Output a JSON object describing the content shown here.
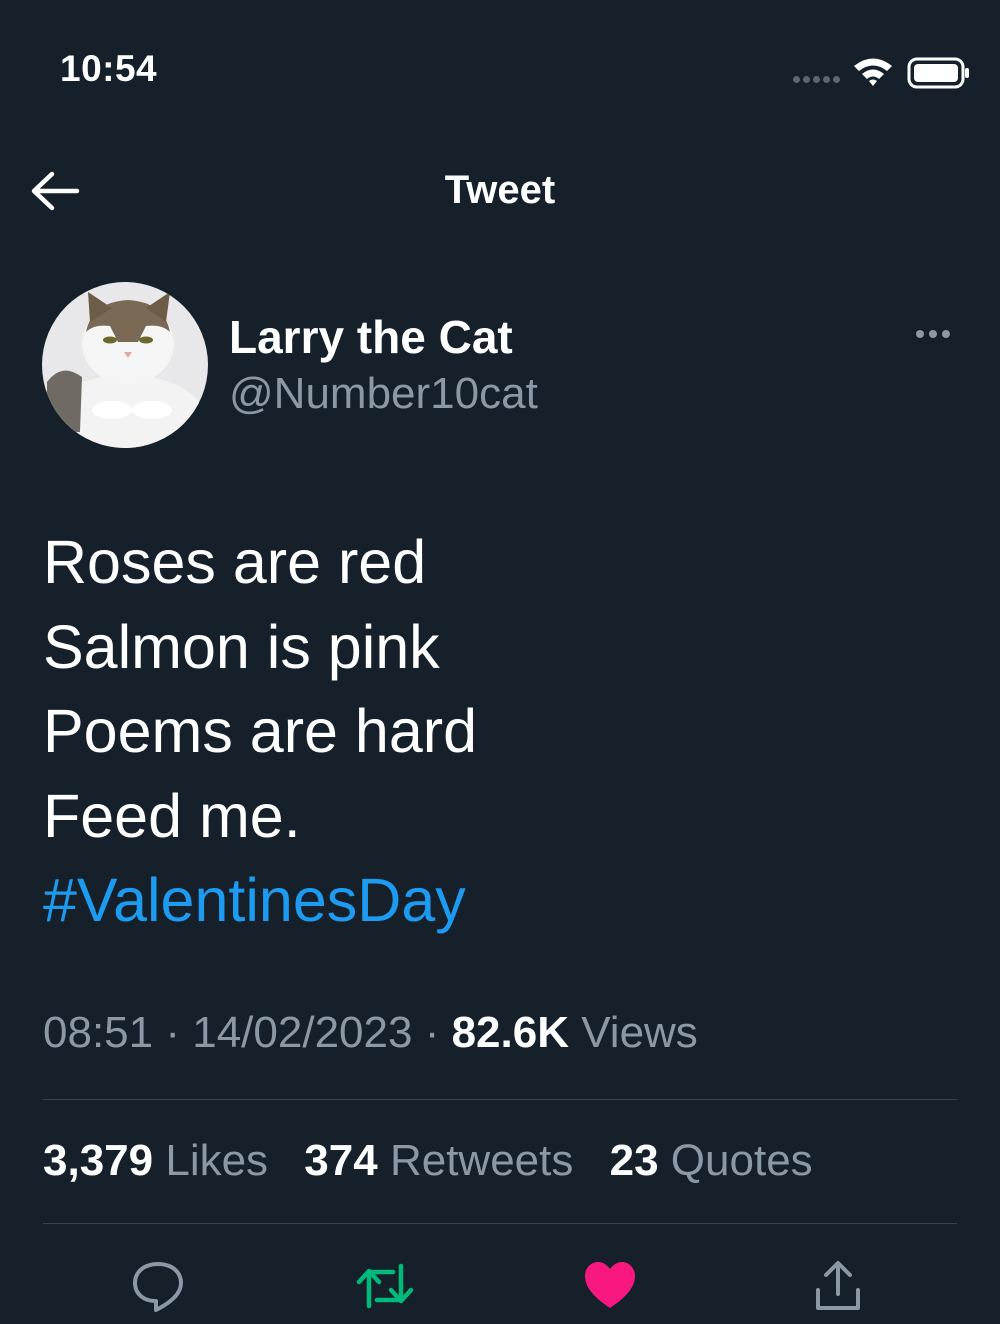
{
  "status_bar": {
    "time": "10:54",
    "icons": [
      "signal-icon",
      "wifi-icon",
      "battery-icon"
    ]
  },
  "header": {
    "title": "Tweet",
    "back_icon": "arrow-left-icon"
  },
  "author": {
    "display_name": "Larry the Cat",
    "handle": "@Number10cat",
    "more_icon": "more-horizontal-icon"
  },
  "tweet": {
    "lines": [
      "Roses are red",
      "Salmon is pink",
      "Poems are hard",
      "Feed me."
    ],
    "hashtag": "#ValentinesDay"
  },
  "meta": {
    "time": "08:51",
    "separator": "·",
    "date": "14/02/2023",
    "views_count": "82.6K",
    "views_label": "Views"
  },
  "stats": {
    "likes_count": "3,379",
    "likes_label": "Likes",
    "retweets_count": "374",
    "retweets_label": "Retweets",
    "quotes_count": "23",
    "quotes_label": "Quotes"
  },
  "actions": [
    {
      "name": "reply",
      "icon": "reply-icon"
    },
    {
      "name": "retweet",
      "icon": "retweet-icon"
    },
    {
      "name": "like",
      "icon": "heart-icon"
    },
    {
      "name": "share",
      "icon": "share-icon"
    }
  ],
  "colors": {
    "background": "#15202b",
    "text_primary": "#ffffff",
    "text_secondary": "#8b98a5",
    "accent_link": "#1d9bf0",
    "retweet": "#00ba7c",
    "like": "#f91880",
    "divider": "#38444d"
  }
}
